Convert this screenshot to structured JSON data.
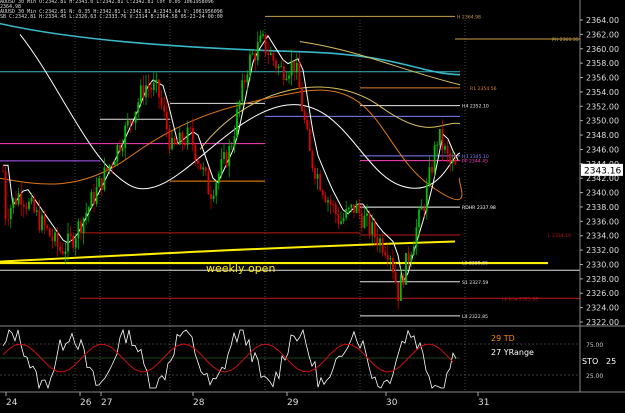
{
  "info_bar": {
    "line1": "AUUSD  30 Min   O:2342.81  H:2343.0  L:2342.81  C:2342.81  lot  0.05  1061958096",
    "line2": "2364.98",
    "line3": "AUUSD 30 Min  C:2342.81  N:  0.35  H:2342.81  L:2342.81  A:2343.64  V:  1061956096",
    "line4": "SB  C:2342.81  H:2334.45  L:2326.63  C:2333.76  V:2314  B:2364.58  05-23-24 00:00"
  },
  "price_axis": {
    "ticks": [
      "2364.00",
      "2362.00",
      "2360.00",
      "2358.00",
      "2356.00",
      "2354.00",
      "2352.00",
      "2350.00",
      "2348.00",
      "2346.00",
      "2344.00",
      "2342.00",
      "2340.00",
      "2338.00",
      "2336.00",
      "2334.00",
      "2332.00",
      "2330.00",
      "2328.00",
      "2326.00",
      "2324.00",
      "2322.00"
    ],
    "current_price": "2343.16"
  },
  "level_labels": {
    "h_top": "H  2364.98",
    "ph": "PH  2361.35",
    "r1": "R1  2354.56",
    "h4": "H4  2352.10",
    "h3": "H3  2345.10",
    "pp": "PP  2344.45",
    "rdhr": "RDHR  2337.98",
    "l": "L  2334.10",
    "l3": "L3  2330.26",
    "s1": "S1  2327.59",
    "lw_low": "Lk Low  2325.28",
    "l4": "L4  2322.85"
  },
  "annotation": "weekly open",
  "x_axis": {
    "ticks": [
      "24",
      "26",
      "27",
      "28",
      "29",
      "30",
      "31"
    ]
  },
  "indicator": {
    "label_td": "29 TD",
    "label_range": "27 YRange",
    "label_sto": "STO",
    "sto_value": "25",
    "y_ticks": [
      "75.00",
      "25.00"
    ]
  },
  "colors": {
    "background": "#000000",
    "bull_candle": "#00c000",
    "bear_candle": "#e00000",
    "weekly_open": "#ffee00",
    "ema_white": "#ffffff",
    "ema_cyan": "#3ab8c8",
    "ema_khaki": "#d8c060",
    "ema_orange": "#e07818"
  }
}
